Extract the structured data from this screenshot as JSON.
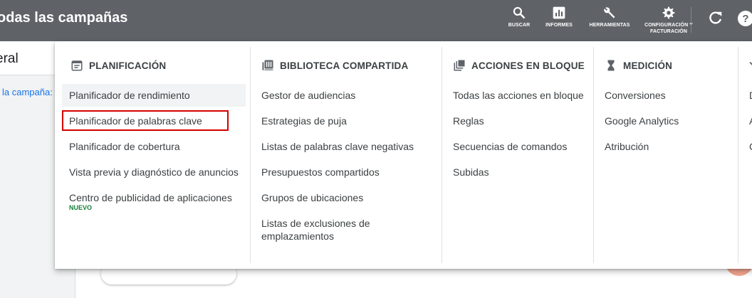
{
  "header": {
    "title": "odas las campañas",
    "tools": [
      {
        "label": "BUSCAR",
        "icon": "search-icon"
      },
      {
        "label": "INFORMES",
        "icon": "reports-icon"
      },
      {
        "label": "HERRAMIENTAS",
        "icon": "wrench-icon"
      },
      {
        "label": "CONFIGURACIÓN Y FACTURACIÓN",
        "icon": "gear-icon"
      }
    ],
    "refresh_icon": "refresh-icon",
    "help_icon": "help-icon"
  },
  "background": {
    "section_title": "eral",
    "link_text": "la campaña:"
  },
  "menu": {
    "columns": [
      {
        "heading": "PLANIFICACIÓN",
        "icon": "calendar-icon",
        "items": [
          {
            "label": "Planificador de rendimiento"
          },
          {
            "label": "Planificador de palabras clave"
          },
          {
            "label": "Planificador de cobertura"
          },
          {
            "label": "Vista previa y diagnóstico de anuncios"
          },
          {
            "label": "Centro de publicidad de aplicaciones",
            "badge": "NUEVO"
          }
        ]
      },
      {
        "heading": "BIBLIOTECA COMPARTIDA",
        "icon": "library-icon",
        "items": [
          {
            "label": "Gestor de audiencias"
          },
          {
            "label": "Estrategias de puja"
          },
          {
            "label": "Listas de palabras clave negativas"
          },
          {
            "label": "Presupuestos compartidos"
          },
          {
            "label": "Grupos de ubicaciones"
          },
          {
            "label": "Listas de exclusiones de",
            "label2": "emplazamientos"
          }
        ]
      },
      {
        "heading": "ACCIONES EN BLOQUE",
        "icon": "copy-icon",
        "items": [
          {
            "label": "Todas las acciones en bloque"
          },
          {
            "label": "Reglas"
          },
          {
            "label": "Secuencias de comandos"
          },
          {
            "label": "Subidas"
          }
        ]
      },
      {
        "heading": "MEDICIÓN",
        "icon": "hourglass-icon",
        "items": [
          {
            "label": "Conversiones"
          },
          {
            "label": "Google Analytics"
          },
          {
            "label": "Atribución"
          }
        ]
      },
      {
        "heading": "",
        "icon": "chevron-icon",
        "items": [
          {
            "label": "D"
          },
          {
            "label": "A"
          },
          {
            "label": "C"
          }
        ]
      }
    ]
  },
  "colors": {
    "topbar": "#5f6368",
    "highlight": "#f1f3f4",
    "annotation_box": "#d50000",
    "badge_green": "#188038",
    "link_blue": "#1a73e8"
  }
}
